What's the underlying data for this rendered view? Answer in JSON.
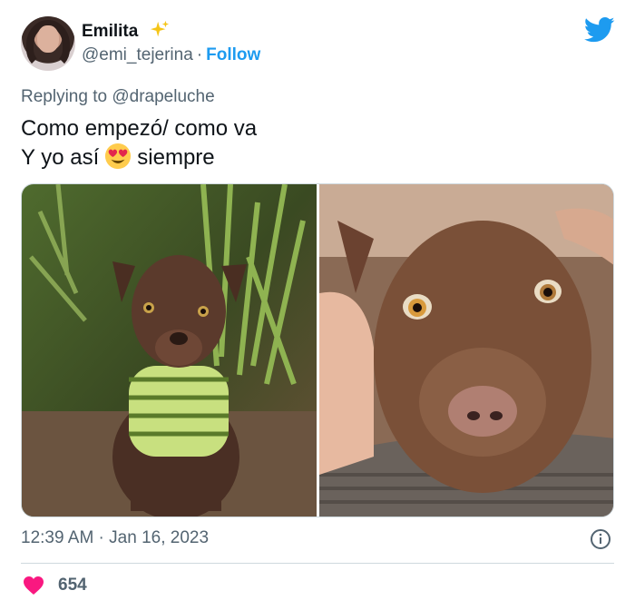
{
  "user": {
    "name": "Emilita",
    "handle": "@emi_tejerina",
    "separator": "·",
    "follow_label": "Follow"
  },
  "tweet": {
    "replying_prefix": "Replying to",
    "replying_to": "@drapeluche",
    "line1": "Como empezó/ como va",
    "line2_start": "Y yo así",
    "line2_end": "siempre",
    "timestamp": "12:39 AM · Jan 16, 2023"
  },
  "engagement": {
    "likes": "654"
  },
  "icons": {
    "brand": "twitter-bird-icon",
    "sparkle": "sparkles-icon",
    "emoji": "heart-eyes-emoji-icon",
    "info": "info-icon",
    "like": "heart-icon"
  },
  "colors": {
    "accent": "#1d9bf0",
    "like": "#f91880",
    "muted": "#536471",
    "text": "#0f1419"
  }
}
